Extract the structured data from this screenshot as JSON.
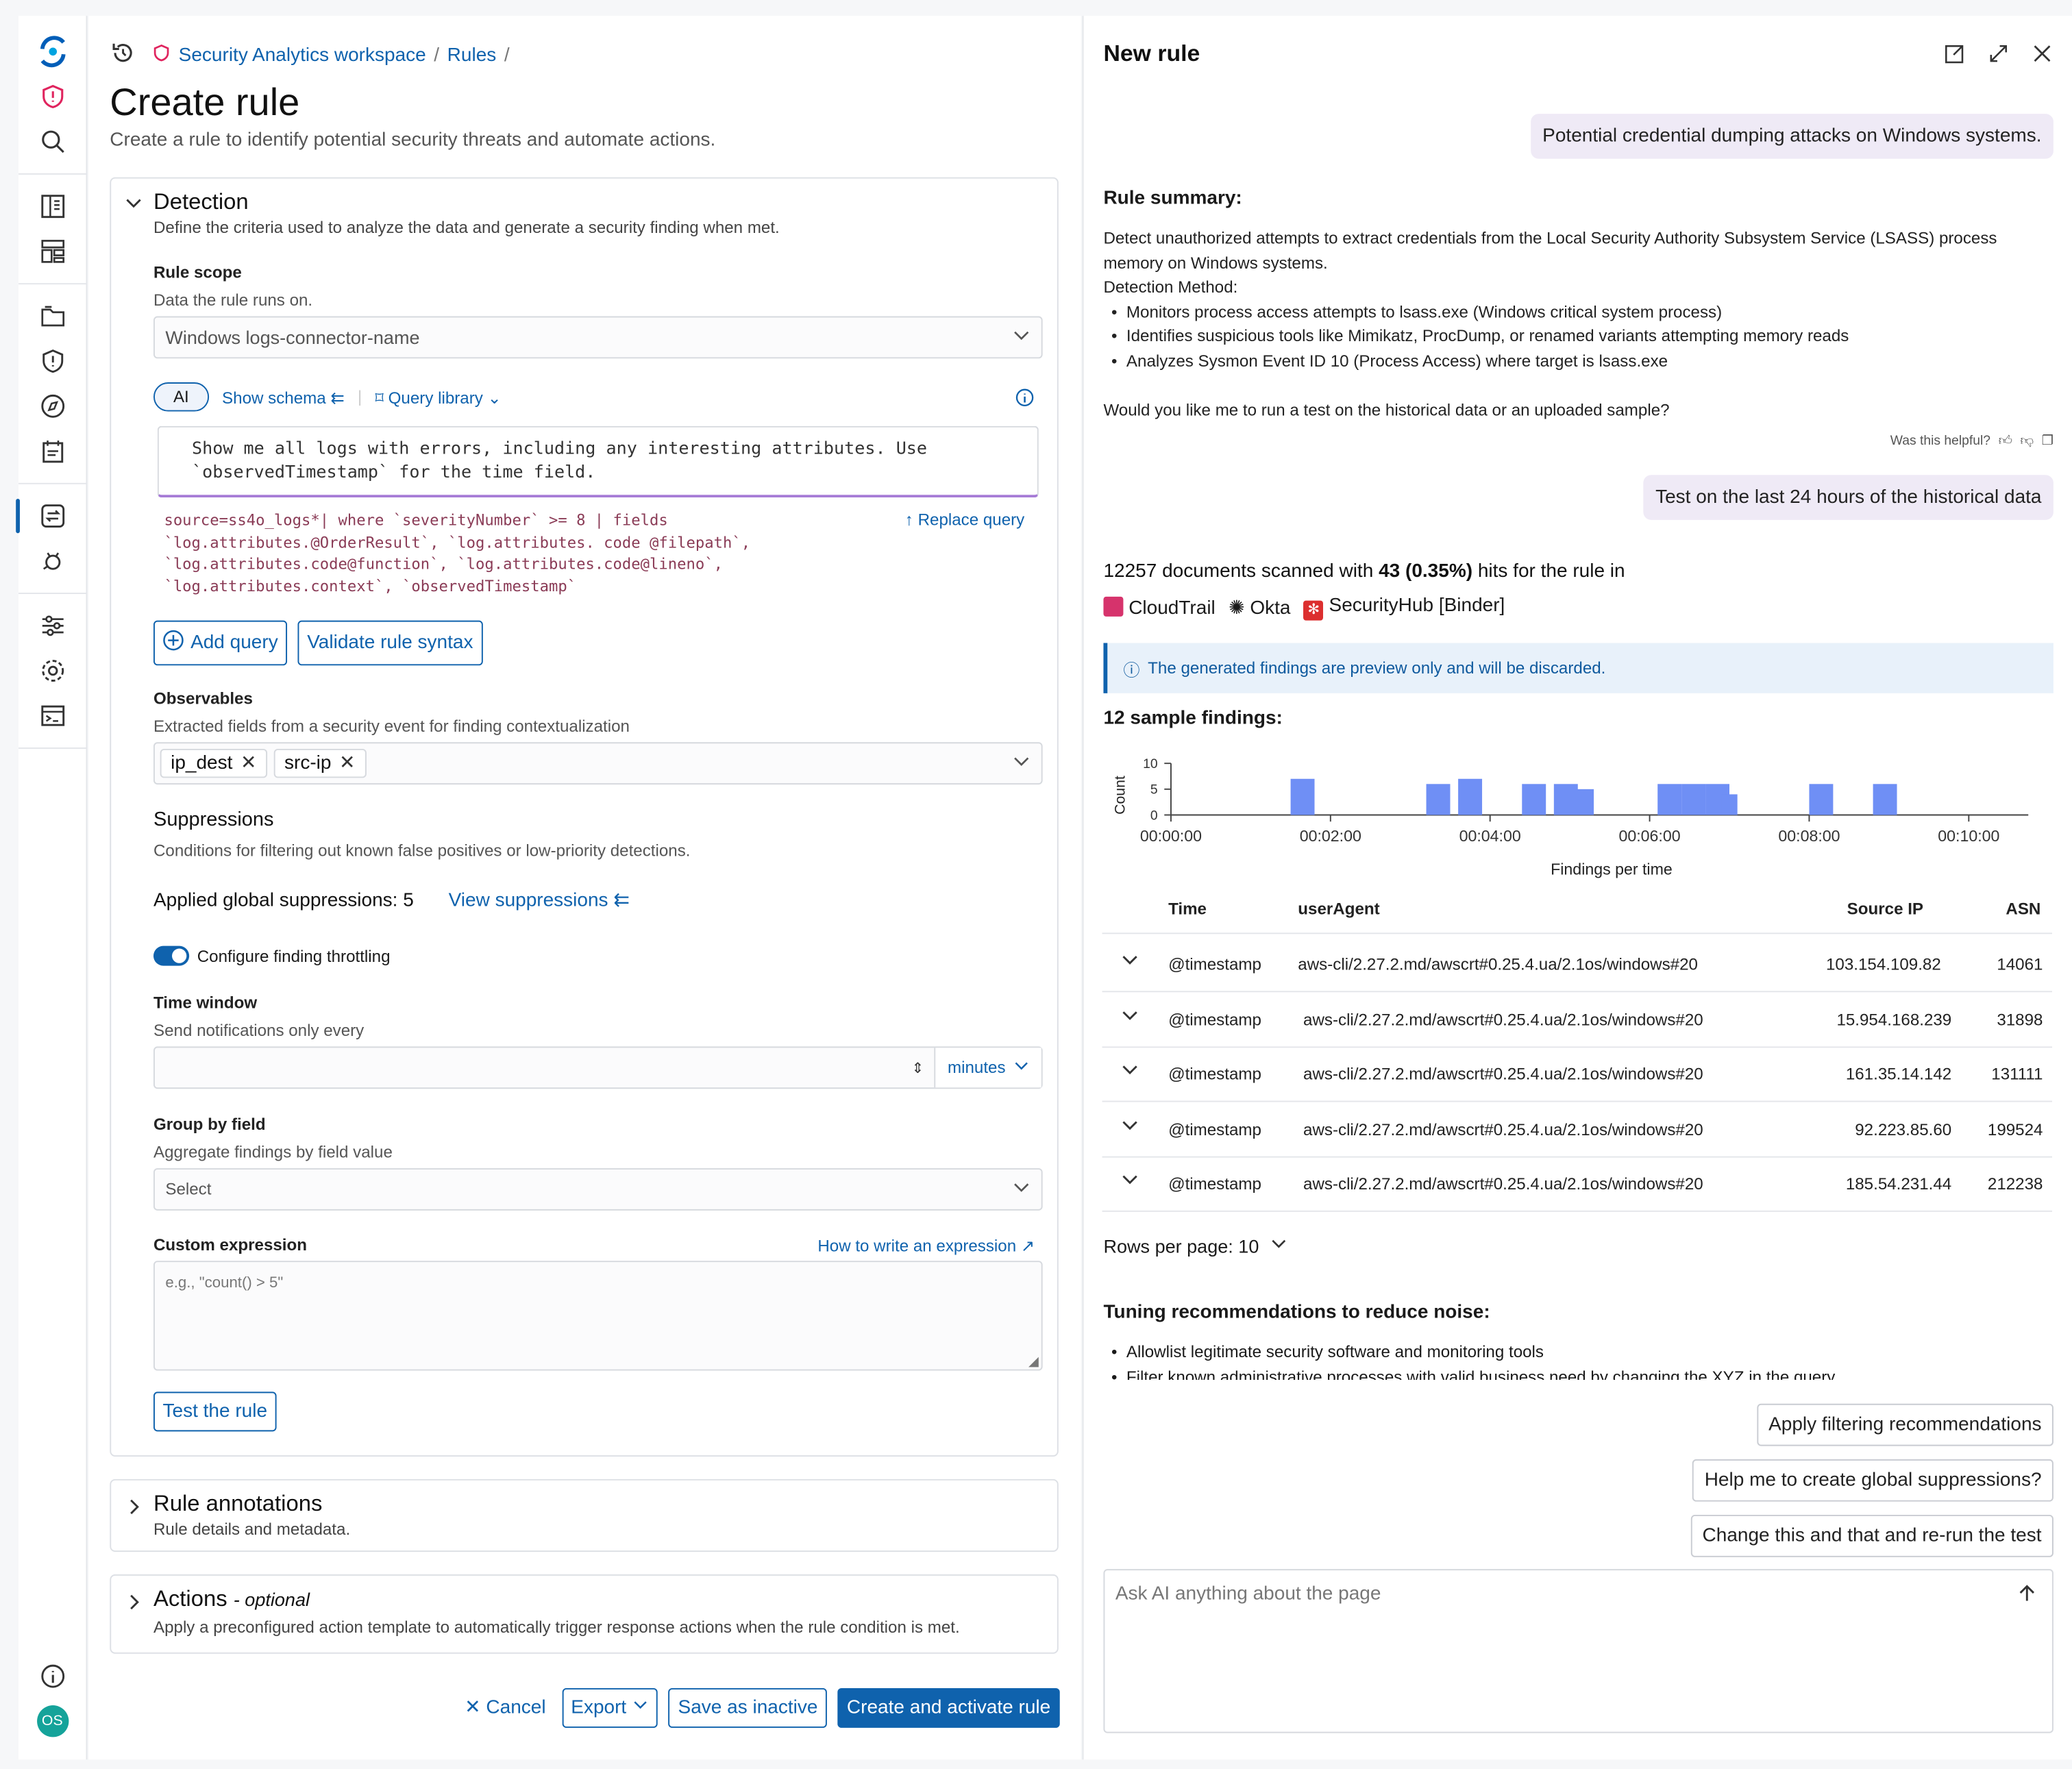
{
  "avatar_initials": "OS",
  "breadcrumb": {
    "workspace": "Security Analytics workspace",
    "rules": "Rules"
  },
  "page": {
    "title": "Create rule",
    "subtitle": "Create a rule to identify potential security threats and automate actions."
  },
  "detection": {
    "title": "Detection",
    "desc": "Define the criteria used to analyze the data and generate a security finding when met.",
    "rule_scope_label": "Rule scope",
    "rule_scope_help": "Data the rule runs on.",
    "rule_scope_value": "Windows logs-connector-name",
    "ai_tab": "AI",
    "show_schema": "Show schema",
    "query_library": "Query library",
    "prompt_line1": "Show me all logs with errors, including any interesting attributes. Use",
    "prompt_line2": "`observedTimestamp` for the time field.",
    "query_line1": "source=ss4o_logs*| where `severityNumber` >= 8 | fields",
    "query_line2": "`log.attributes.@OrderResult`, `log.attributes. code @filepath`,",
    "query_line3": "`log.attributes.code@function`, `log.attributes.code@lineno`,",
    "query_line4": "`log.attributes.context`, `observedTimestamp`",
    "replace_query": "Replace query",
    "add_query": "Add query",
    "validate": "Validate rule syntax",
    "observables_label": "Observables",
    "observables_help": "Extracted fields from a security event for finding contextualization",
    "observables": [
      "ip_dest",
      "src-ip"
    ],
    "suppressions_title": "Suppressions",
    "suppressions_desc": "Conditions for filtering out known false positives or low-priority detections.",
    "applied": "Applied global suppressions: 5",
    "view_suppressions": "View suppressions",
    "throttling": "Configure finding throttling",
    "time_window_label": "Time window",
    "time_window_help": "Send notifications only every",
    "time_unit": "minutes",
    "group_label": "Group by field",
    "group_help": "Aggregate findings by field value",
    "group_placeholder": "Select",
    "custom_label": "Custom expression",
    "custom_link": "How to write an expression",
    "custom_placeholder": "e.g., \"count() > 5\"",
    "test_rule": "Test the rule"
  },
  "annotations": {
    "title": "Rule annotations",
    "desc": "Rule details and metadata."
  },
  "actions": {
    "title": "Actions",
    "optional": "- optional",
    "desc": "Apply a preconfigured action template to automatically trigger response actions when the rule condition is met."
  },
  "footer": {
    "cancel": "Cancel",
    "export": "Export",
    "save_inactive": "Save as inactive",
    "create": "Create and activate rule"
  },
  "panel": {
    "title": "New rule",
    "user_msg1": "Potential credential dumping attacks on Windows systems.",
    "summary_title": "Rule summary:",
    "summary_p1": "Detect unauthorized attempts to extract credentials from the Local Security Authority Subsystem Service (LSASS) process memory on Windows systems.",
    "method_label": "Detection Method:",
    "bullets": [
      "Monitors process access attempts to lsass.exe (Windows critical system process)",
      "Identifies suspicious tools like Mimikatz, ProcDump, or renamed variants attempting memory reads",
      "Analyzes Sysmon Event ID 10 (Process Access) where target is lsass.exe"
    ],
    "question": "Would you like me to run a test on the historical data or an uploaded sample?",
    "helpful": "Was this helpful?",
    "user_msg2": "Test on the last 24 hours of the historical data",
    "scan_a": "12257 documents scanned with",
    "scan_b": "43 (0.35%)",
    "scan_c": "hits for the rule in",
    "sources": [
      "CloudTrail",
      "Okta",
      "SecurityHub [Binder]"
    ],
    "notice": "The generated findings are preview only and will be discarded.",
    "findings_title": "12 sample findings:",
    "table_headers": [
      "Time",
      "userAgent",
      "Source IP",
      "ASN"
    ],
    "rows": [
      [
        "@timestamp",
        "aws-cli/2.27.2.md/awscrt#0.25.4.ua/2.1os/windows#20",
        "103.154.109.82",
        "14061"
      ],
      [
        "@timestamp",
        "aws-cli/2.27.2.md/awscrt#0.25.4.ua/2.1os/windows#20",
        "15.954.168.239",
        "31898"
      ],
      [
        "@timestamp",
        "aws-cli/2.27.2.md/awscrt#0.25.4.ua/2.1os/windows#20",
        "161.35.14.142",
        "131111"
      ],
      [
        "@timestamp",
        "aws-cli/2.27.2.md/awscrt#0.25.4.ua/2.1os/windows#20",
        "92.223.85.60",
        "199524"
      ],
      [
        "@timestamp",
        "aws-cli/2.27.2.md/awscrt#0.25.4.ua/2.1os/windows#20",
        "185.54.231.44",
        "212238"
      ]
    ],
    "rows_per_page": "Rows per page: 10",
    "tuning_title": "Tuning recommendations to reduce noise:",
    "tuning": [
      "Allowlist legitimate security software and monitoring tools",
      "Filter known administrative processes with valid business need by changing the XYZ in the query"
    ],
    "sugg": [
      "Apply filtering recommendations",
      "Help me to create global suppressions?",
      "Change this and that and re-run the test"
    ],
    "ask_placeholder": "Ask AI anything about the page"
  },
  "chart_data": {
    "type": "bar",
    "title": "",
    "xlabel": "Findings per time",
    "ylabel": "Count",
    "ylim": [
      0,
      10
    ],
    "yticks": [
      "10",
      "5",
      "0"
    ],
    "xticks": [
      "00:00:00",
      "00:02:00",
      "00:04:00",
      "00:06:00",
      "00:08:00",
      "00:10:00"
    ],
    "color": "#6f8ff5",
    "bars": [
      {
        "x_min": 1.5,
        "x_max": 1.8,
        "y": 7
      },
      {
        "x_min": 3.2,
        "x_max": 3.5,
        "y": 6
      },
      {
        "x_min": 3.6,
        "x_max": 3.9,
        "y": 7
      },
      {
        "x_min": 4.4,
        "x_max": 4.7,
        "y": 6
      },
      {
        "x_min": 4.8,
        "x_max": 5.1,
        "y": 6
      },
      {
        "x_min": 5.0,
        "x_max": 5.3,
        "y": 5
      },
      {
        "x_min": 6.1,
        "x_max": 6.4,
        "y": 6
      },
      {
        "x_min": 6.4,
        "x_max": 6.7,
        "y": 6
      },
      {
        "x_min": 6.7,
        "x_max": 7.0,
        "y": 6
      },
      {
        "x_min": 6.9,
        "x_max": 7.1,
        "y": 4
      },
      {
        "x_min": 8.0,
        "x_max": 8.3,
        "y": 6
      },
      {
        "x_min": 8.8,
        "x_max": 9.1,
        "y": 6
      }
    ]
  }
}
